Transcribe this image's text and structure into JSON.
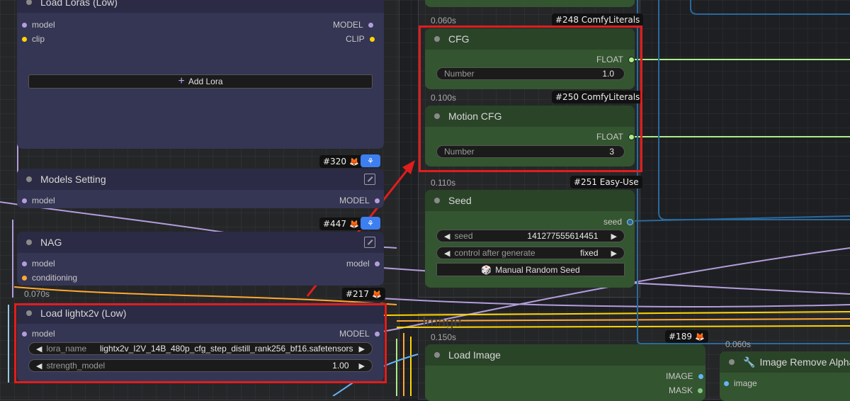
{
  "colors": {
    "highlight": "#e11d1d",
    "model_wire": "#b39ddb",
    "float_wire": "#aaee88",
    "int_wire": "#29699c",
    "clip_wire": "#ffd500",
    "cond_wire": "#ffa931"
  },
  "nodes": {
    "load_loras_low": {
      "title": "Load Loras (Low)",
      "inputs": [
        "model",
        "clip"
      ],
      "outputs": [
        "MODEL",
        "CLIP"
      ],
      "add_lora": "Add Lora"
    },
    "models_setting": {
      "title": "Models Setting",
      "badge": "#320",
      "inputs": [
        "model"
      ],
      "outputs": [
        "MODEL"
      ]
    },
    "nag": {
      "title": "NAG",
      "badge": "#447",
      "inputs": [
        "model",
        "conditioning"
      ],
      "outputs": [
        "model"
      ]
    },
    "load_lightx2v": {
      "title": "Load lightx2v (Low)",
      "time": "0.070s",
      "badge": "#217",
      "inputs": [
        "model"
      ],
      "outputs": [
        "MODEL"
      ],
      "lora_name_label": "lora_name",
      "lora_name_value": "lightx2v_I2V_14B_480p_cfg_step_distill_rank256_bf16.safetensors",
      "strength_label": "strength_model",
      "strength_value": "1.00"
    },
    "top_green": {
      "time": "0.060s",
      "badge": "#248 ComfyLiterals"
    },
    "cfg": {
      "title": "CFG",
      "output": "FLOAT",
      "widget_label": "Number",
      "widget_value": "1.0"
    },
    "motion_cfg": {
      "title": "Motion CFG",
      "time": "0.100s",
      "badge": "#250 ComfyLiterals",
      "output": "FLOAT",
      "widget_label": "Number",
      "widget_value": "3"
    },
    "seed": {
      "title": "Seed",
      "time": "0.110s",
      "badge": "#251 Easy-Use",
      "output": "seed",
      "seed_label": "seed",
      "seed_value": "141277555614451",
      "control_label": "control after generate",
      "control_value": "fixed",
      "random_btn": "Manual Random Seed"
    },
    "load_image": {
      "title": "Load Image",
      "time": "0.150s",
      "badge": "#189",
      "outputs": [
        "IMAGE",
        "MASK"
      ],
      "group_label": "Image"
    },
    "remove_alpha": {
      "title": "Image Remove Alpha",
      "time": "0.060s",
      "inputs": [
        "image"
      ]
    }
  }
}
